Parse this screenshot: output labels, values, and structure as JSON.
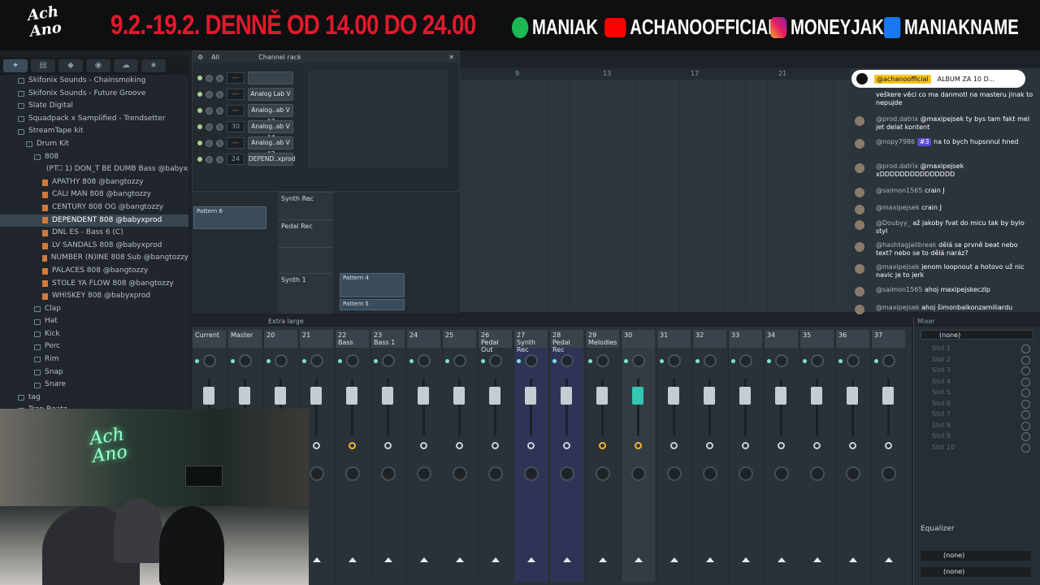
{
  "banner": {
    "logo": "Ach Ano",
    "dates": "9.2.-19.2. DENNĚ OD 14.00 DO 24.00",
    "spotify": "MANIAK",
    "youtube": "ACHANOOFFICIAL",
    "instagram": "MONEYJAK",
    "facebook": "MANIAKNAME"
  },
  "browser": {
    "tabs": [
      "⌖",
      "▤",
      "◆",
      "◉",
      "☁",
      "★"
    ],
    "items": [
      {
        "label": "Skifonix Sounds - Chainsmoking",
        "type": "folder",
        "indent": 0
      },
      {
        "label": "Skifonix Sounds - Future Groove",
        "type": "folder",
        "indent": 0
      },
      {
        "label": "Slate Digital",
        "type": "folder",
        "indent": 0
      },
      {
        "label": "Squadpack x Samplified - Trendsetter",
        "type": "folder",
        "indent": 0
      },
      {
        "label": "StreamTape kit",
        "type": "folder",
        "indent": 0
      },
      {
        "label": "Drum Kit",
        "type": "folder",
        "indent": 1
      },
      {
        "label": "808",
        "type": "folder",
        "indent": 2
      },
      {
        "label": "(PT⎕ 1) DON_T BE DUMB Bass @babyxprod",
        "type": "file",
        "indent": 3
      },
      {
        "label": "APATHY 808 @bangtozzy",
        "type": "file",
        "indent": 3
      },
      {
        "label": "CALI MAN 808 @bangtozzy",
        "type": "file",
        "indent": 3
      },
      {
        "label": "CENTURY 808 OG @bangtozzy",
        "type": "file",
        "indent": 3
      },
      {
        "label": "DEPENDENT 808 @babyxprod",
        "type": "file",
        "indent": 3,
        "selected": true
      },
      {
        "label": "DNL ES - Bass 6 (C)",
        "type": "file",
        "indent": 3
      },
      {
        "label": "LV SANDALS 808 @babyxprod",
        "type": "file",
        "indent": 3
      },
      {
        "label": "NUMBER (N)INE 808 Sub @bangtozzy",
        "type": "file",
        "indent": 3
      },
      {
        "label": "PALACES 808 @bangtozzy",
        "type": "file",
        "indent": 3
      },
      {
        "label": "STOLE YA FLOW 808 @bangtozzy",
        "type": "file",
        "indent": 3
      },
      {
        "label": "WHISKEY 808 @babyxprod",
        "type": "file",
        "indent": 3
      },
      {
        "label": "Clap",
        "type": "folder",
        "indent": 2
      },
      {
        "label": "Hat",
        "type": "folder",
        "indent": 2
      },
      {
        "label": "Kick",
        "type": "folder",
        "indent": 2
      },
      {
        "label": "Perc",
        "type": "folder",
        "indent": 2
      },
      {
        "label": "Rim",
        "type": "folder",
        "indent": 2
      },
      {
        "label": "Snap",
        "type": "folder",
        "indent": 2
      },
      {
        "label": "Snare",
        "type": "folder",
        "indent": 2
      },
      {
        "label": "tag",
        "type": "folder",
        "indent": 0
      },
      {
        "label": "Trap Beatz",
        "type": "folder",
        "indent": 0
      }
    ]
  },
  "channel_rack": {
    "filter": "All",
    "title": "Channel rack",
    "channels": [
      {
        "num": "---",
        "name": ""
      },
      {
        "num": "---",
        "name": "Analog Lab V"
      },
      {
        "num": "---",
        "name": "Analog..ab V #3"
      },
      {
        "num": "30",
        "name": "Analog..ab V #4"
      },
      {
        "num": "---",
        "name": "Analog..ab V #2"
      },
      {
        "num": "24",
        "name": "DEPEND..xprod"
      }
    ]
  },
  "playlist": {
    "bars": [
      "9",
      "13",
      "17",
      "21"
    ],
    "tracks": [
      "Synth Rec",
      "Pedal Rec",
      "",
      "Synth 1"
    ],
    "pattern_picker": "Pattern 6",
    "clips": [
      "Pattern 4",
      "Pattern 5"
    ]
  },
  "chat": {
    "pinned_user": "@achanoofficial",
    "pinned_text": "ALBUM ZA 10 D...",
    "messages": [
      {
        "user": "",
        "text": "veškere věci co ma danmotl na masteru jinak to nepujde"
      },
      {
        "user": "@prod.datrix",
        "text": "@maxipejsek ty bys tam fakt mel jet delat kontent"
      },
      {
        "user": "@nopy7986",
        "badge": "#3",
        "text": "na to bych hupsnnul hned"
      },
      {
        "user": "@prod.datrix",
        "text": "@maxipejsek xDDDDDDDDDDDDDDD"
      },
      {
        "user": "@saimon1565",
        "text": "crain J"
      },
      {
        "user": "@maxipejsek",
        "text": "crain J"
      },
      {
        "user": "@Doubyy_",
        "text": "až jakoby fvat do micu tak by bylo styl"
      },
      {
        "user": "@hashtagjailbreak",
        "text": "dělá se prvně beat nebo text? nebo se to dělá naráz?"
      },
      {
        "user": "@maxipejsek",
        "text": "jenom loopnout a hotovo už nic navic je to jerk"
      },
      {
        "user": "@saimon1565",
        "text": "ahoj maxipejskeczlp"
      },
      {
        "user": "@maxipejsek",
        "text": "ahoj šimonbalkonzamiliardu"
      }
    ]
  },
  "mixer": {
    "view": "Extra large",
    "strips": [
      {
        "label": "Current",
        "num": ""
      },
      {
        "label": "Master",
        "num": ""
      },
      {
        "label": "",
        "num": "20"
      },
      {
        "label": "",
        "num": "21"
      },
      {
        "label": "Bass",
        "num": "22"
      },
      {
        "label": "Bass 1",
        "num": "23"
      },
      {
        "label": "",
        "num": "24"
      },
      {
        "label": "",
        "num": "25"
      },
      {
        "label": "Pedal Out",
        "num": "26"
      },
      {
        "label": "Synth Rec",
        "num": "27"
      },
      {
        "label": "Pedal Rec",
        "num": "28"
      },
      {
        "label": "Melodies",
        "num": "29"
      },
      {
        "label": "",
        "num": "30"
      },
      {
        "label": "",
        "num": "31"
      },
      {
        "label": "",
        "num": "32"
      },
      {
        "label": "",
        "num": "33"
      },
      {
        "label": "",
        "num": "34"
      },
      {
        "label": "",
        "num": "35"
      },
      {
        "label": "",
        "num": "36"
      },
      {
        "label": "",
        "num": "37"
      }
    ],
    "panel_title": "Mixer",
    "insert": "(none)",
    "slots": [
      "Slot 1",
      "Slot 2",
      "Slot 3",
      "Slot 4",
      "Slot 5",
      "Slot 6",
      "Slot 7",
      "Slot 8",
      "Slot 9",
      "Slot 10"
    ],
    "equalizer": "Equalizer",
    "out_a": "(none)",
    "out_b": "(none)"
  },
  "colors": {
    "banner_red": "#e01a2c",
    "teal": "#35c6b4",
    "highlight_strip": "#2f3457"
  }
}
